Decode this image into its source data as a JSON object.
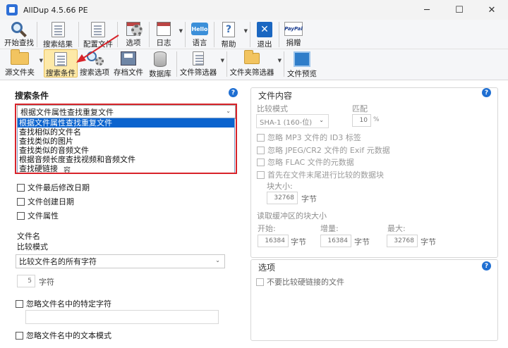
{
  "window": {
    "title": "AllDup 4.5.66 PE",
    "minimize": "─",
    "maximize": "☐",
    "close": "✕"
  },
  "toolbar_top": [
    {
      "label": "开始查找",
      "icon": "magnifier-icon"
    },
    {
      "label": "搜索结果",
      "icon": "search-results-icon"
    },
    {
      "label": "配置文件",
      "icon": "profile-icon"
    },
    {
      "label": "选项",
      "icon": "options-gear-icon"
    },
    {
      "label": "日志",
      "icon": "log-icon"
    },
    {
      "label": "语言",
      "icon": "language-hello-icon",
      "icon_text": "Hello"
    },
    {
      "label": "帮助",
      "icon": "help-icon",
      "icon_text": "?"
    },
    {
      "label": "退出",
      "icon": "exit-icon",
      "icon_text": "✕"
    },
    {
      "label": "捐赠",
      "icon": "paypal-icon",
      "icon_text": "PayPal"
    }
  ],
  "toolbar_bottom": [
    {
      "label": "源文件夹",
      "icon": "source-folder-icon"
    },
    {
      "label": "搜索条件",
      "icon": "search-criteria-icon",
      "active": true
    },
    {
      "label": "搜索选项",
      "icon": "search-options-icon"
    },
    {
      "label": "存档文件",
      "icon": "archive-icon"
    },
    {
      "label": "数据库",
      "icon": "database-icon"
    },
    {
      "label": "文件筛选器",
      "icon": "file-filter-icon"
    },
    {
      "label": "文件夹筛选器",
      "icon": "folder-filter-icon"
    },
    {
      "label": "文件预览",
      "icon": "file-preview-icon"
    }
  ],
  "search_criteria": {
    "title": "搜索条件",
    "selected": "根据文件属性查找重复文件",
    "options": [
      "根据文件属性查找重复文件",
      "查找相似的文件名",
      "查找类似的图片",
      "查找类似的音频文件",
      "根据音频长度查找视频和音频文件",
      "查找硬链接"
    ],
    "hidden_partial_label": "容",
    "checkboxes": [
      "文件最后修改日期",
      "文件创建日期",
      "文件属性"
    ],
    "filename_label": "文件名",
    "compare_mode_label": "比较模式",
    "filename_compare_selected": "比较文件名的所有字符",
    "chars_value": "5",
    "chars_unit": "字符",
    "ignore_chars_label": "忽略文件名中的特定字符",
    "ignore_pattern_label": "忽略文件名中的文本模式"
  },
  "file_content": {
    "title": "文件内容",
    "compare_mode_label": "比较模式",
    "compare_mode_value": "SHA-1 (160-位)",
    "match_label": "匹配",
    "match_value": "10",
    "match_unit": "%",
    "options": [
      "忽略 MP3 文件的 ID3 标签",
      "忽略 JPEG/CR2 文件的 Exif 元数据",
      "忽略 FLAC 文件的元数据",
      "首先在文件末尾进行比较的数据块"
    ],
    "block_size_label": "块大小:",
    "block_size_value": "32768",
    "bytes_unit": "字节",
    "buffer_label": "读取缓冲区的块大小",
    "start_label": "开始:",
    "start_value": "16384",
    "increment_label": "增量:",
    "increment_value": "16384",
    "max_label": "最大:",
    "max_value": "32768"
  },
  "options_group": {
    "title": "选项",
    "no_hardlink_label": "不要比较硬链接的文件"
  }
}
